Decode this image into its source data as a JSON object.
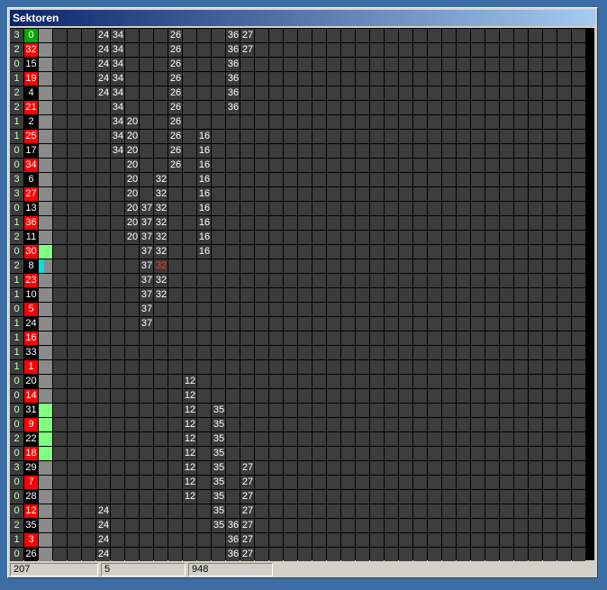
{
  "window": {
    "title": "Sektoren"
  },
  "colors": {
    "grid_cell": "#3c3c3c",
    "gray_col": "#8a8a8a",
    "red": "#ff0000",
    "green_cur": "#00aa00",
    "light_green": "#80ff80",
    "cyan": "#00e0e0",
    "black": "#000000"
  },
  "rows": [
    {
      "count": "3",
      "id": "0",
      "id_bg": "#00aa00",
      "mark": "",
      "values": [
        [
          "24",
          "34"
        ],
        [],
        [],
        [],
        [
          "26-"
        ],
        [],
        [],
        [],
        [],
        [
          "36",
          "27"
        ]
      ]
    },
    {
      "count": "2",
      "id": "32",
      "id_bg": "red",
      "mark": "",
      "values": [
        "24 34",
        "26",
        "36 27"
      ]
    },
    {
      "count": "0",
      "id": "15",
      "id_bg": "black",
      "mark": "",
      "values": [
        "24 34",
        "26",
        "36"
      ]
    },
    {
      "count": "1",
      "id": "19",
      "id_bg": "red",
      "mark": "",
      "values": [
        "24 34",
        "26",
        "36"
      ]
    },
    {
      "count": "2",
      "id": "4",
      "id_bg": "black",
      "mark": "",
      "values": [
        "24 34",
        "26",
        "36"
      ]
    },
    {
      "count": "2",
      "id": "21",
      "id_bg": "red",
      "mark": "",
      "values": [
        "34",
        "26",
        "36"
      ]
    },
    {
      "count": "1",
      "id": "2",
      "id_bg": "black",
      "mark": "",
      "values": [
        "34 20",
        "26"
      ]
    },
    {
      "count": "1",
      "id": "25",
      "id_bg": "red",
      "mark": "",
      "values": [
        "34 20",
        "26",
        "16"
      ]
    },
    {
      "count": "0",
      "id": "17",
      "id_bg": "black",
      "mark": "",
      "values": [
        "34 20",
        "26",
        "16"
      ]
    },
    {
      "count": "0",
      "id": "34",
      "id_bg": "red",
      "mark": "",
      "values": [
        "20",
        "26",
        "16"
      ]
    },
    {
      "count": "3",
      "id": "6",
      "id_bg": "black",
      "mark": "",
      "values": [
        "20",
        "32",
        "16"
      ]
    },
    {
      "count": "3",
      "id": "27",
      "id_bg": "red",
      "mark": "",
      "values": [
        "20",
        "32",
        "16"
      ]
    },
    {
      "count": "0",
      "id": "13",
      "id_bg": "black",
      "mark": "",
      "values": [
        "20 37 32",
        "16"
      ]
    },
    {
      "count": "1",
      "id": "36",
      "id_bg": "red",
      "mark": "",
      "values": [
        "20 37 32",
        "16"
      ]
    },
    {
      "count": "2",
      "id": "11",
      "id_bg": "black",
      "mark": "",
      "values": [
        "20 37 32",
        "16"
      ]
    },
    {
      "count": "0",
      "id": "30",
      "id_bg": "red",
      "mark": "green",
      "values": [
        "37 32",
        "16"
      ]
    },
    {
      "count": "2",
      "id": "8",
      "id_bg": "black",
      "mark": "cyan",
      "values": [
        "37 32r"
      ]
    },
    {
      "count": "1",
      "id": "23",
      "id_bg": "red",
      "mark": "",
      "values": [
        "37 32"
      ]
    },
    {
      "count": "1",
      "id": "10",
      "id_bg": "black",
      "mark": "",
      "values": [
        "37 32"
      ]
    },
    {
      "count": "0",
      "id": "5",
      "id_bg": "red",
      "mark": "",
      "values": [
        "37"
      ]
    },
    {
      "count": "1",
      "id": "24",
      "id_bg": "black",
      "mark": "",
      "values": [
        "37"
      ]
    },
    {
      "count": "1",
      "id": "16",
      "id_bg": "red",
      "mark": "",
      "values": []
    },
    {
      "count": "1",
      "id": "33",
      "id_bg": "black",
      "mark": "",
      "values": []
    },
    {
      "count": "1",
      "id": "1",
      "id_bg": "red",
      "mark": "",
      "values": []
    },
    {
      "count": "0",
      "id": "20",
      "id_bg": "black",
      "mark": "",
      "values": [
        "12"
      ]
    },
    {
      "count": "0",
      "id": "14",
      "id_bg": "red",
      "mark": "",
      "values": [
        "12"
      ]
    },
    {
      "count": "0",
      "id": "31",
      "id_bg": "black",
      "mark": "green",
      "values": [
        "12",
        "35"
      ]
    },
    {
      "count": "0",
      "id": "9",
      "id_bg": "red",
      "mark": "green",
      "values": [
        "12",
        "35"
      ]
    },
    {
      "count": "2",
      "id": "22",
      "id_bg": "black",
      "mark": "green",
      "values": [
        "12",
        "35"
      ]
    },
    {
      "count": "0",
      "id": "18",
      "id_bg": "red",
      "mark": "green",
      "values": [
        "12",
        "35"
      ]
    },
    {
      "count": "3",
      "id": "29",
      "id_bg": "black",
      "mark": "",
      "values": [
        "12",
        "35",
        "27"
      ]
    },
    {
      "count": "0",
      "id": "7",
      "id_bg": "red",
      "mark": "",
      "values": [
        "12",
        "35",
        "27"
      ]
    },
    {
      "count": "0",
      "id": "28",
      "id_bg": "black",
      "mark": "",
      "values": [
        "12",
        "35",
        "27"
      ]
    },
    {
      "count": "0",
      "id": "12",
      "id_bg": "red",
      "mark": "",
      "values": [
        "24",
        "35",
        "27"
      ]
    },
    {
      "count": "2",
      "id": "35",
      "id_bg": "black",
      "mark": "",
      "values": [
        "24",
        "35 36 27"
      ]
    },
    {
      "count": "1",
      "id": "3",
      "id_bg": "red",
      "mark": "",
      "values": [
        "24",
        "36 27"
      ]
    },
    {
      "count": "0",
      "id": "26",
      "id_bg": "black",
      "mark": "",
      "values": [
        "24",
        "36 27"
      ]
    }
  ],
  "cells": [
    [
      [
        3,
        "24"
      ],
      [
        4,
        "34"
      ],
      [
        8,
        "26"
      ],
      [
        12,
        "36"
      ],
      [
        13,
        "27"
      ]
    ],
    [
      [
        3,
        "24"
      ],
      [
        4,
        "34"
      ],
      [
        8,
        "26"
      ],
      [
        12,
        "36"
      ],
      [
        13,
        "27"
      ]
    ],
    [
      [
        3,
        "24"
      ],
      [
        4,
        "34"
      ],
      [
        8,
        "26"
      ],
      [
        12,
        "36"
      ]
    ],
    [
      [
        3,
        "24"
      ],
      [
        4,
        "34"
      ],
      [
        8,
        "26"
      ],
      [
        12,
        "36"
      ]
    ],
    [
      [
        3,
        "24"
      ],
      [
        4,
        "34"
      ],
      [
        8,
        "26"
      ],
      [
        12,
        "36"
      ]
    ],
    [
      [
        4,
        "34"
      ],
      [
        8,
        "26"
      ],
      [
        12,
        "36"
      ]
    ],
    [
      [
        4,
        "34"
      ],
      [
        5,
        "20"
      ],
      [
        8,
        "26"
      ]
    ],
    [
      [
        4,
        "34"
      ],
      [
        5,
        "20"
      ],
      [
        8,
        "26"
      ],
      [
        10,
        "16"
      ]
    ],
    [
      [
        4,
        "34"
      ],
      [
        5,
        "20"
      ],
      [
        8,
        "26"
      ],
      [
        10,
        "16"
      ]
    ],
    [
      [
        5,
        "20"
      ],
      [
        8,
        "26"
      ],
      [
        10,
        "16"
      ]
    ],
    [
      [
        5,
        "20"
      ],
      [
        7,
        "32"
      ],
      [
        10,
        "16"
      ]
    ],
    [
      [
        5,
        "20"
      ],
      [
        7,
        "32"
      ],
      [
        10,
        "16"
      ]
    ],
    [
      [
        5,
        "20"
      ],
      [
        6,
        "37"
      ],
      [
        7,
        "32"
      ],
      [
        10,
        "16"
      ]
    ],
    [
      [
        5,
        "20"
      ],
      [
        6,
        "37"
      ],
      [
        7,
        "32"
      ],
      [
        10,
        "16"
      ]
    ],
    [
      [
        5,
        "20"
      ],
      [
        6,
        "37"
      ],
      [
        7,
        "32"
      ],
      [
        10,
        "16"
      ]
    ],
    [
      [
        6,
        "37"
      ],
      [
        7,
        "32"
      ],
      [
        10,
        "16"
      ]
    ],
    [
      [
        6,
        "37"
      ],
      [
        7,
        "32",
        "red"
      ]
    ],
    [
      [
        6,
        "37"
      ],
      [
        7,
        "32"
      ]
    ],
    [
      [
        6,
        "37"
      ],
      [
        7,
        "32"
      ]
    ],
    [
      [
        6,
        "37"
      ]
    ],
    [
      [
        6,
        "37"
      ]
    ],
    [],
    [],
    [],
    [
      [
        9,
        "12"
      ]
    ],
    [
      [
        9,
        "12"
      ]
    ],
    [
      [
        9,
        "12"
      ],
      [
        11,
        "35"
      ]
    ],
    [
      [
        9,
        "12"
      ],
      [
        11,
        "35"
      ]
    ],
    [
      [
        9,
        "12"
      ],
      [
        11,
        "35"
      ]
    ],
    [
      [
        9,
        "12"
      ],
      [
        11,
        "35"
      ]
    ],
    [
      [
        9,
        "12"
      ],
      [
        11,
        "35"
      ],
      [
        13,
        "27"
      ]
    ],
    [
      [
        9,
        "12"
      ],
      [
        11,
        "35"
      ],
      [
        13,
        "27"
      ]
    ],
    [
      [
        9,
        "12"
      ],
      [
        11,
        "35"
      ],
      [
        13,
        "27"
      ]
    ],
    [
      [
        3,
        "24"
      ],
      [
        11,
        "35"
      ],
      [
        13,
        "27"
      ]
    ],
    [
      [
        3,
        "24"
      ],
      [
        11,
        "35"
      ],
      [
        12,
        "36"
      ],
      [
        13,
        "27"
      ]
    ],
    [
      [
        3,
        "24"
      ],
      [
        12,
        "36"
      ],
      [
        13,
        "27"
      ]
    ],
    [
      [
        3,
        "24"
      ],
      [
        12,
        "36"
      ],
      [
        13,
        "27"
      ]
    ]
  ],
  "status": {
    "field1": "207",
    "field2": "5",
    "field3": "948"
  }
}
